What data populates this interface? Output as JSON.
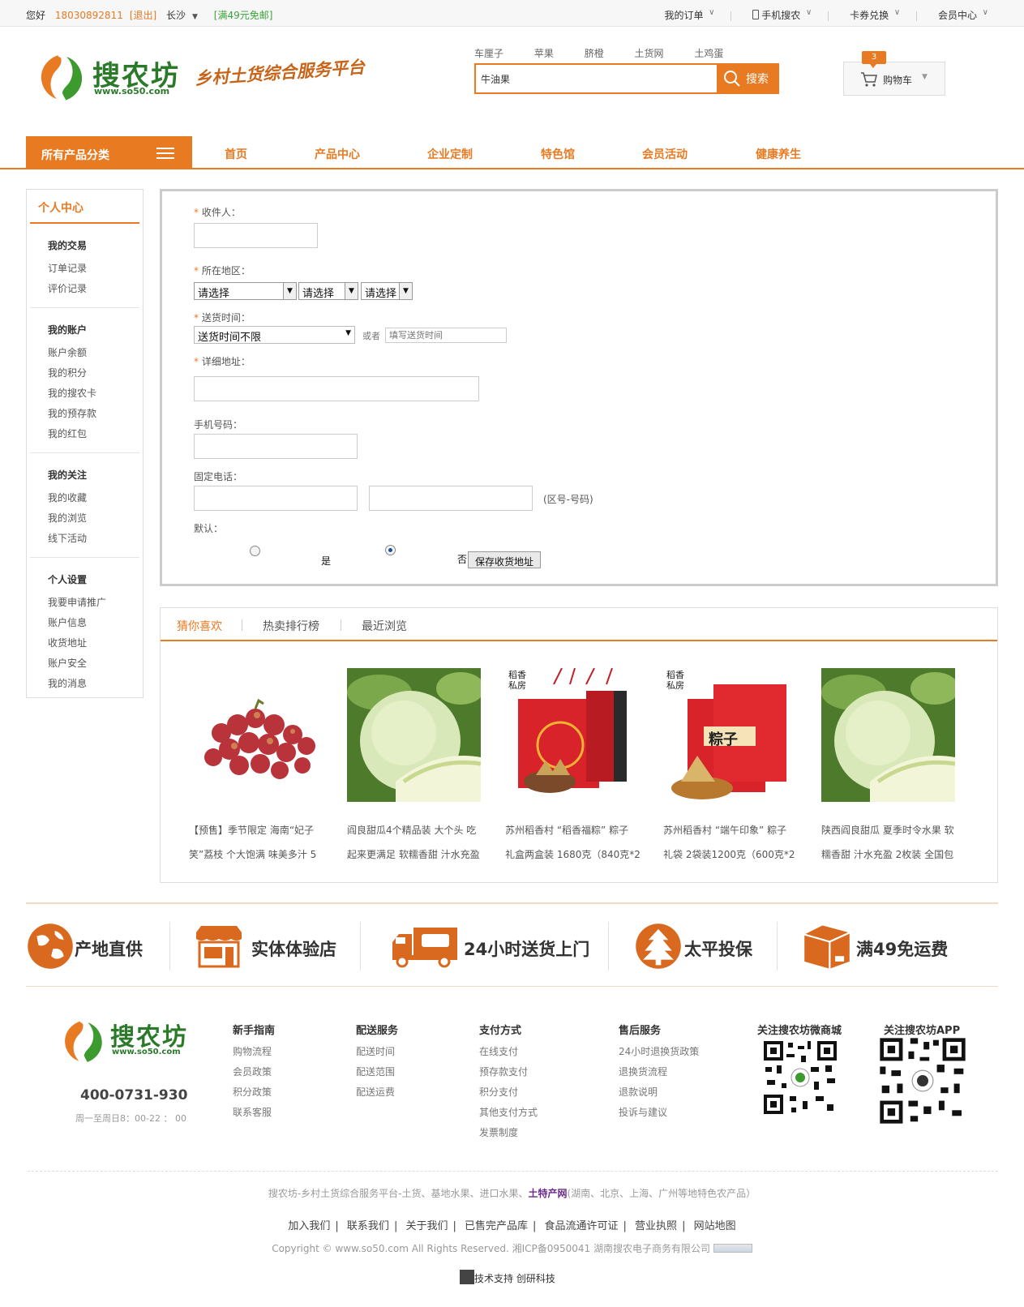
{
  "topbar": {
    "greeting": "您好",
    "phone": "18030892811",
    "logout": "[退出]",
    "city": "长沙",
    "promo": "[满49元免邮]",
    "links": [
      "我的订单",
      "手机搜农",
      "卡券兑换",
      "会员中心"
    ]
  },
  "header": {
    "logo_text": "搜农坊",
    "logo_url": "www.so50.com",
    "slogan": "乡村土货综合服务平台",
    "hotwords": [
      "车厘子",
      "苹果",
      "脐橙",
      "土货网",
      "土鸡蛋"
    ],
    "search_value": "牛油果",
    "search_button": "搜索",
    "cart_count": "3",
    "cart_label": "购物车"
  },
  "nav": {
    "category": "所有产品分类",
    "items": [
      "首页",
      "产品中心",
      "企业定制",
      "特色馆",
      "会员活动",
      "健康养生"
    ]
  },
  "sidebar": {
    "title": "个人中心",
    "groups": [
      {
        "title": "我的交易",
        "items": [
          "订单记录",
          "评价记录"
        ]
      },
      {
        "title": "我的账户",
        "items": [
          "账户余额",
          "我的积分",
          "我的搜农卡",
          "我的预存款",
          "我的红包"
        ]
      },
      {
        "title": "我的关注",
        "items": [
          "我的收藏",
          "我的浏览",
          "线下活动"
        ]
      },
      {
        "title": "个人设置",
        "items": [
          "我要申请推广",
          "账户信息",
          "收货地址",
          "账户安全",
          "我的消息"
        ]
      }
    ]
  },
  "form": {
    "receiver_label": "收件人：",
    "region_label": "所在地区：",
    "region_selects": [
      "请选择",
      "请选择",
      "请选择"
    ],
    "delivery_label": "送货时间：",
    "delivery_value": "送货时间不限",
    "or_label": "或者",
    "delivery_placeholder": "填写送货时间",
    "address_label": "详细地址：",
    "mobile_label": "手机号码：",
    "landline_label": "固定电话：",
    "landline_hint": "(区号-号码)",
    "default_label": "默认：",
    "yes_label": "是",
    "no_label": "否",
    "default_selected": "否",
    "save_button": "保存收货地址",
    "required_mark": "*"
  },
  "recommend": {
    "tabs": [
      "猜你喜欢",
      "热卖排行榜",
      "最近浏览"
    ],
    "products": [
      {
        "line1": "【预售】季节限定 海南“妃子",
        "line2": "笑”荔枝 个大饱满 味美多汁 5"
      },
      {
        "line1": "阎良甜瓜4个精品装 大个头 吃",
        "line2": "起来更满足 软糯香甜 汁水充盈"
      },
      {
        "line1": "苏州稻香村 “稻香福粽” 粽子",
        "line2": "礼盒两盒装 1680克（840克*2"
      },
      {
        "line1": "苏州稻香村 “端午印象” 粽子",
        "line2": "礼袋 2袋装1200克（600克*2"
      },
      {
        "line1": "陕西阎良甜瓜 夏季时令水果 软",
        "line2": "糯香甜 汁水充盈 2枚装 全国包"
      }
    ],
    "box_text": "稻香私房",
    "zongzi_text": "粽子"
  },
  "features": [
    "产地直供",
    "实体体验店",
    "24小时送货上门",
    "太平投保",
    "满49免运费"
  ],
  "footer": {
    "logo_text": "搜农坊",
    "logo_url": "www.so50.com",
    "phone": "400-0731-930",
    "hours": "周一至周日8：00-22 ： 00",
    "columns": [
      {
        "title": "新手指南",
        "items": [
          "购物流程",
          "会员政策",
          "积分政策",
          "联系客服"
        ]
      },
      {
        "title": "配送服务",
        "items": [
          "配送时间",
          "配送范围",
          "配送运费"
        ]
      },
      {
        "title": "支付方式",
        "items": [
          "在线支付",
          "预存款支付",
          "积分支付",
          "其他支付方式",
          "发票制度"
        ]
      },
      {
        "title": "售后服务",
        "items": [
          "24小时退换货政策",
          "退换货流程",
          "退款说明",
          "投诉与建议"
        ]
      }
    ],
    "qr_titles": [
      "关注搜农坊微商城",
      "关注搜农坊APP"
    ],
    "desc_pre": "搜农坊-乡村土货综合服务平台-土货、基地水果、进口水果、",
    "desc_link": "土特产网",
    "desc_post": "(湖南、北京、上海、广州等地特色农产品）",
    "links": [
      "加入我们",
      "联系我们",
      "关于我们",
      "已售完产品库",
      "食品流通许可证",
      "营业执照",
      "网站地图"
    ],
    "copyright": "Copyright © www.so50.com All Rights Reserved. 湘ICP备0950041 湖南搜农电子商务有限公司",
    "tech": "技术支持 创研科技"
  },
  "colors": {
    "accent": "#e87a22",
    "brand_green": "#2a7a2a"
  }
}
